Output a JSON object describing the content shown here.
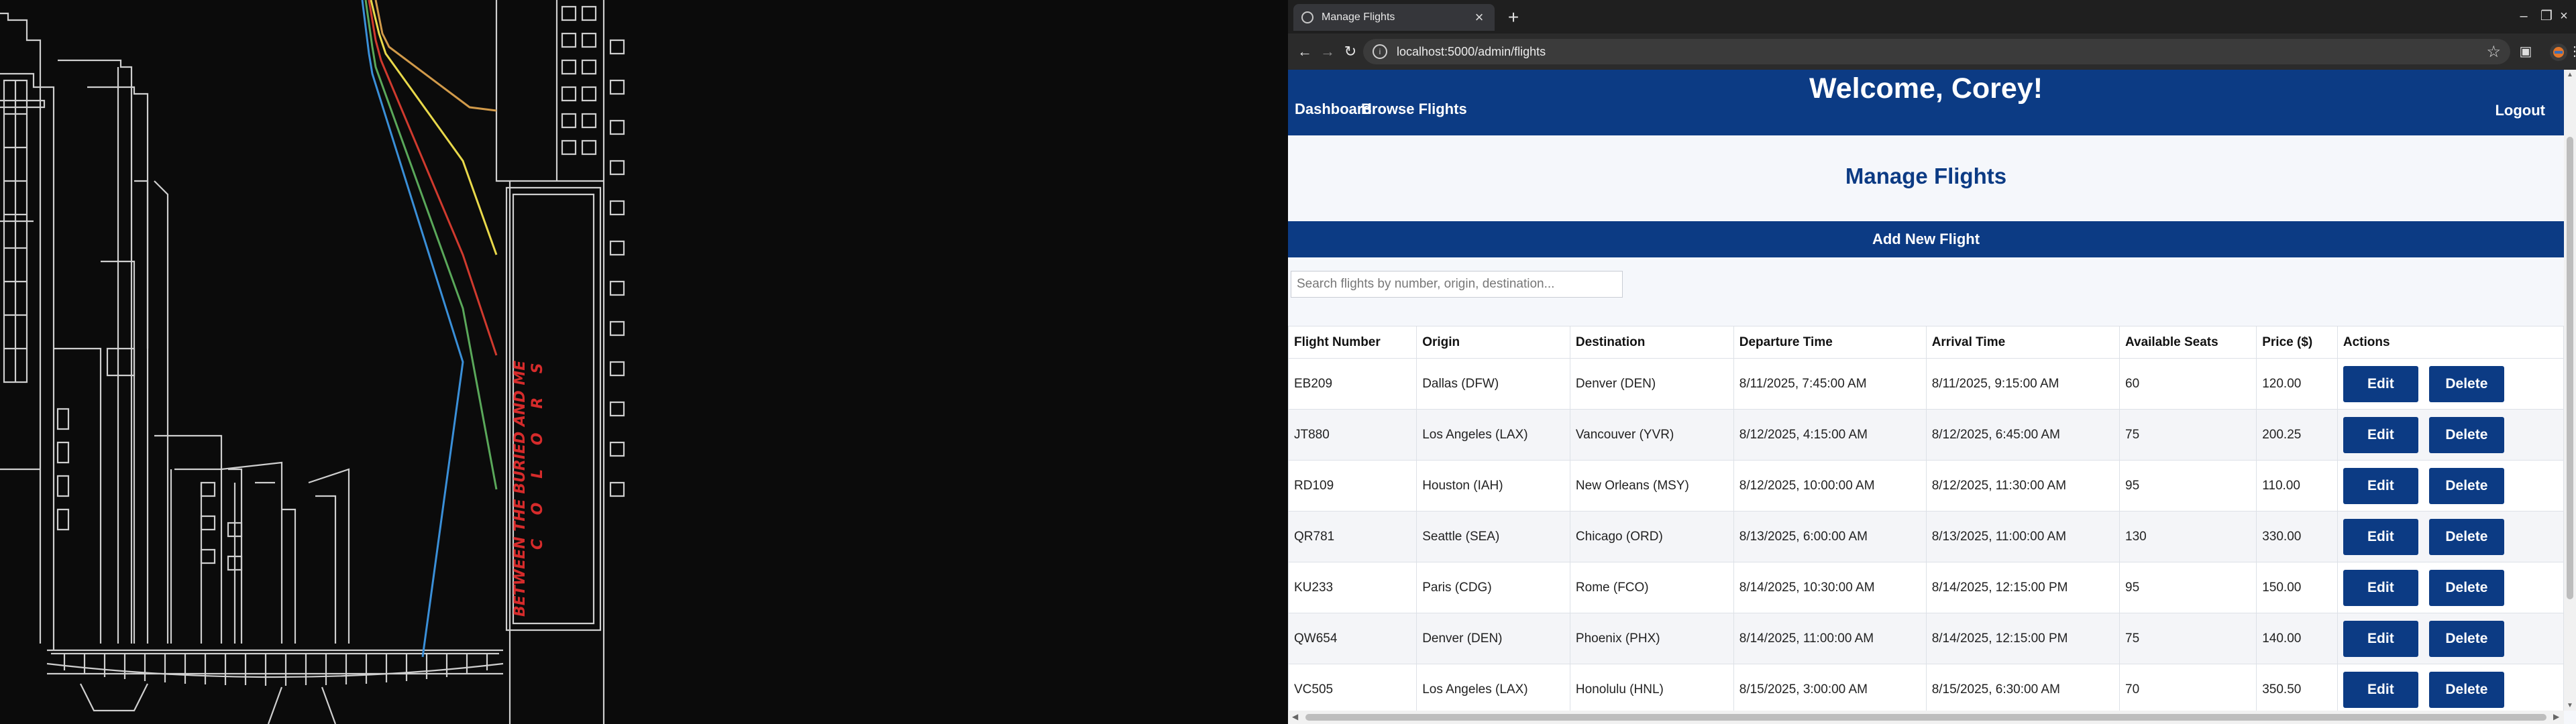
{
  "wallpaper": {
    "sign_line1": "BETWEEN THE BURIED AND ME",
    "sign_line2": "C O L O R S"
  },
  "browser": {
    "tab_title": "Manage Flights",
    "tab_close": "×",
    "new_tab": "+",
    "url": "localhost:5000/admin/flights",
    "window_controls": [
      "–",
      "❐",
      "×"
    ]
  },
  "page": {
    "nav": {
      "dashboard": "Dashboard",
      "browse": "Browse Flights",
      "logout": "Logout"
    },
    "welcome": "Welcome, Corey!",
    "heading": "Manage Flights",
    "add_button": "Add New Flight",
    "search": {
      "placeholder": "Search flights by number, origin, destination...",
      "value": ""
    }
  },
  "table": {
    "headers": [
      "Flight Number",
      "Origin",
      "Destination",
      "Departure Time",
      "Arrival Time",
      "Available Seats",
      "Price ($)",
      "Actions"
    ],
    "edit_label": "Edit",
    "delete_label": "Delete",
    "rows": [
      [
        "EB209",
        "Dallas (DFW)",
        "Denver (DEN)",
        "8/11/2025, 7:45:00 AM",
        "8/11/2025, 9:15:00 AM",
        "60",
        "120.00"
      ],
      [
        "JT880",
        "Los Angeles (LAX)",
        "Vancouver (YVR)",
        "8/12/2025, 4:15:00 AM",
        "8/12/2025, 6:45:00 AM",
        "75",
        "200.25"
      ],
      [
        "RD109",
        "Houston (IAH)",
        "New Orleans (MSY)",
        "8/12/2025, 10:00:00 AM",
        "8/12/2025, 11:30:00 AM",
        "95",
        "110.00"
      ],
      [
        "QR781",
        "Seattle (SEA)",
        "Chicago (ORD)",
        "8/13/2025, 6:00:00 AM",
        "8/13/2025, 11:00:00 AM",
        "130",
        "330.00"
      ],
      [
        "KU233",
        "Paris (CDG)",
        "Rome (FCO)",
        "8/14/2025, 10:30:00 AM",
        "8/14/2025, 12:15:00 PM",
        "95",
        "150.00"
      ],
      [
        "QW654",
        "Denver (DEN)",
        "Phoenix (PHX)",
        "8/14/2025, 11:00:00 AM",
        "8/14/2025, 12:15:00 PM",
        "75",
        "140.00"
      ],
      [
        "VC505",
        "Los Angeles (LAX)",
        "Honolulu (HNL)",
        "8/15/2025, 3:00:00 AM",
        "8/15/2025, 6:30:00 AM",
        "70",
        "350.50"
      ]
    ]
  },
  "colors": {
    "brand": "#0c3b84",
    "page_bg": "#f5f7fb",
    "wallpaper_bg": "#0b0b0b",
    "sign_text": "#d62b2b"
  },
  "icons": [
    "back-arrow-icon",
    "forward-arrow-icon",
    "reload-icon",
    "site-info-icon",
    "bookmark-star-icon",
    "cast-icon",
    "extension-icon",
    "menu-dots-icon"
  ]
}
